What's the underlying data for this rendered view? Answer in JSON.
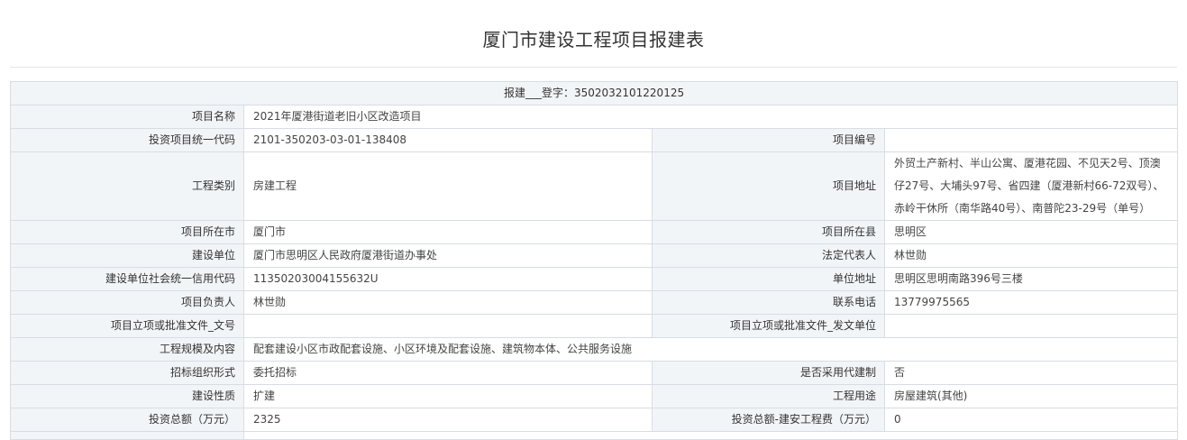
{
  "title": "厦门市建设工程项目报建表",
  "registration": "报建___登字：3502032101220125",
  "rows": {
    "project_name": {
      "label": "项目名称",
      "value": "2021年厦港街道老旧小区改造项目"
    },
    "invest_code": {
      "label": "投资项目统一代码",
      "value": "2101-350203-03-01-138408"
    },
    "project_no": {
      "label": "项目编号",
      "value": ""
    },
    "eng_type": {
      "label": "工程类别",
      "value": "房建工程"
    },
    "address": {
      "label": "项目地址",
      "value": "外贸土产新村、半山公寓、厦港花园、不见天2号、顶澳仔27号、大埔头97号、省四建（厦港新村66-72双号）、赤岭干休所（南华路40号）、南普陀23-29号（单号）"
    },
    "city": {
      "label": "项目所在市",
      "value": "厦门市"
    },
    "county": {
      "label": "项目所在县",
      "value": "思明区"
    },
    "builder": {
      "label": "建设单位",
      "value": "厦门市思明区人民政府厦港街道办事处"
    },
    "legal_rep": {
      "label": "法定代表人",
      "value": "林世勋"
    },
    "credit_code": {
      "label": "建设单位社会统一信用代码",
      "value": "11350203004155632U"
    },
    "unit_addr": {
      "label": "单位地址",
      "value": "思明区思明南路396号三楼"
    },
    "manager": {
      "label": "项目负责人",
      "value": "林世勋"
    },
    "phone": {
      "label": "联系电话",
      "value": "13779975565"
    },
    "doc_no": {
      "label": "项目立项或批准文件_文号",
      "value": ""
    },
    "doc_issuer": {
      "label": "项目立项或批准文件_发文单位",
      "value": ""
    },
    "scale": {
      "label": "工程规模及内容",
      "value": "配套建设小区市政配套设施、小区环境及配套设施、建筑物本体、公共服务设施"
    },
    "tender": {
      "label": "招标组织形式",
      "value": "委托招标"
    },
    "agent": {
      "label": "是否采用代建制",
      "value": "否"
    },
    "nature": {
      "label": "建设性质",
      "value": "扩建"
    },
    "usage": {
      "label": "工程用途",
      "value": "房屋建筑(其他)"
    },
    "invest_total": {
      "label": "投资总额（万元）",
      "value": "2325"
    },
    "invest_build": {
      "label": "投资总额-建安工程费（万元）",
      "value": "0"
    }
  }
}
